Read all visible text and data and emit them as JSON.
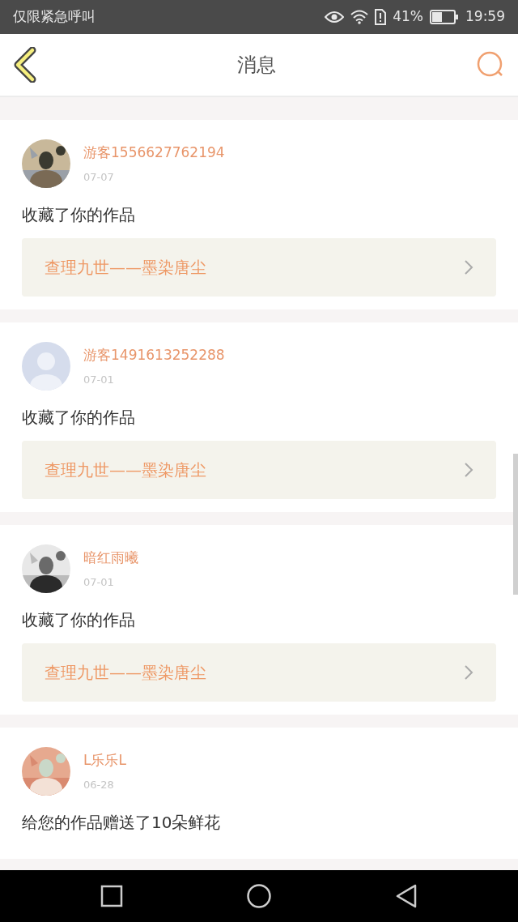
{
  "status_bar": {
    "carrier": "仅限紧急呼叫",
    "battery": "41%",
    "time": "19:59"
  },
  "header": {
    "title": "消息"
  },
  "messages": [
    {
      "name": "游客1556627762194",
      "date": "07-07",
      "kind": "picture",
      "action": "收藏了你的作品",
      "work": "查理九世——墨染唐尘"
    },
    {
      "name": "游客1491613252288",
      "date": "07-01",
      "kind": "default",
      "action": "收藏了你的作品",
      "work": "查理九世——墨染唐尘"
    },
    {
      "name": "暗红雨曦",
      "date": "07-01",
      "kind": "picture",
      "action": "收藏了你的作品",
      "work": "查理九世——墨染唐尘"
    },
    {
      "name": "L乐乐L",
      "date": "06-28",
      "kind": "picture",
      "action": "给您的作品赠送了10朵鲜花"
    }
  ]
}
